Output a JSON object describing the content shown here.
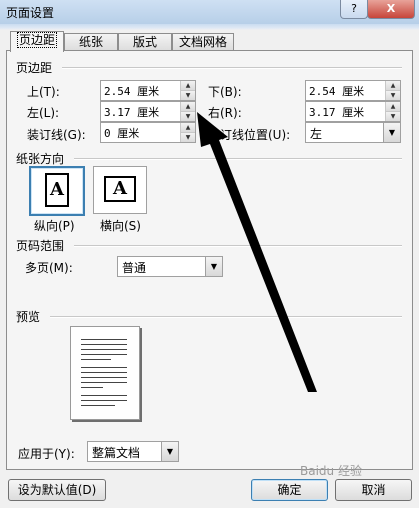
{
  "window": {
    "title": "页面设置",
    "help_label": "?",
    "close_label": "X"
  },
  "tabs": [
    {
      "label": "页边距",
      "active": true
    },
    {
      "label": "纸张",
      "active": false
    },
    {
      "label": "版式",
      "active": false
    },
    {
      "label": "文档网格",
      "active": false
    }
  ],
  "margins": {
    "section_title": "页边距",
    "top_label": "上(T):",
    "top_value": "2.54 厘米",
    "bottom_label": "下(B):",
    "bottom_value": "2.54 厘米",
    "left_label": "左(L):",
    "left_value": "3.17 厘米",
    "right_label": "右(R):",
    "right_value": "3.17 厘米",
    "gutter_label": "装订线(G):",
    "gutter_value": "0 厘米",
    "gutter_pos_label": "装订线位置(U):",
    "gutter_pos_value": "左"
  },
  "orientation": {
    "section_title": "纸张方向",
    "portrait_label": "纵向(P)",
    "landscape_label": "横向(S)",
    "glyph": "A",
    "selected": "portrait"
  },
  "pages": {
    "section_title": "页码范围",
    "multiple_label": "多页(M):",
    "multiple_value": "普通"
  },
  "preview": {
    "section_title": "预览"
  },
  "apply": {
    "label": "应用于(Y):",
    "value": "整篇文档"
  },
  "buttons": {
    "default_label": "设为默认值(D)",
    "ok_label": "确定",
    "cancel_label": "取消"
  },
  "watermark": "Baidu 经验",
  "colors": {
    "accent": "#3c7fb1",
    "arrow": "#000000"
  }
}
